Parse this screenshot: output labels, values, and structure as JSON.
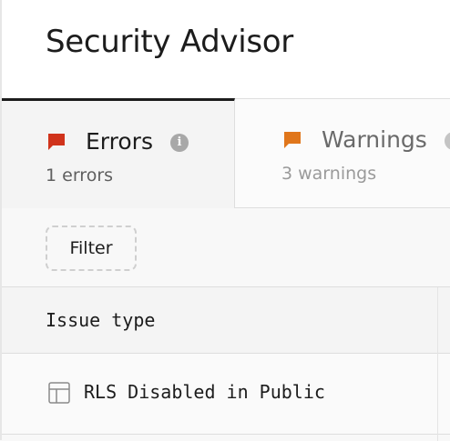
{
  "header": {
    "title": "Security Advisor"
  },
  "tabs": [
    {
      "label": "Errors",
      "sublabel": "1 errors",
      "flag_color": "#d0331b",
      "active": true
    },
    {
      "label": "Warnings",
      "sublabel": "3 warnings",
      "flag_color": "#e0761b",
      "active": false
    }
  ],
  "filter": {
    "label": "Filter"
  },
  "table": {
    "columns": [
      "Issue type"
    ],
    "rows": [
      {
        "issue": "RLS Disabled in Public",
        "icon": "table-icon"
      }
    ]
  },
  "colors": {
    "active_border": "#1c1c1c",
    "error": "#d0331b",
    "warning": "#e0761b"
  }
}
